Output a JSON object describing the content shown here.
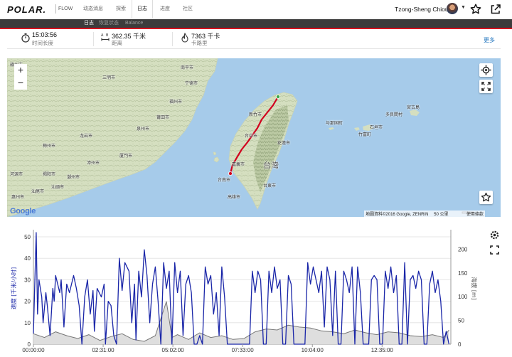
{
  "nav": {
    "logo": "POLAR.",
    "product": "FLOW",
    "tabs": [
      {
        "label": "动态消息"
      },
      {
        "label": "探索"
      },
      {
        "label": "日志"
      },
      {
        "label": "进度"
      },
      {
        "label": "社区"
      }
    ],
    "active_tab": "日志",
    "user_name": "Tzong-Sheng Chiou",
    "icons": [
      "avatar",
      "chevron-down-icon",
      "star-icon",
      "share-icon"
    ]
  },
  "subnav": {
    "tabs": [
      {
        "label": "日志"
      },
      {
        "label": "恢复状态"
      },
      {
        "label": "Balance"
      }
    ],
    "active_tab": "日志"
  },
  "summary": {
    "duration": {
      "value": "15:03:56",
      "label": "时间长度"
    },
    "distance": {
      "value": "362.35 千米",
      "label": "距离"
    },
    "calories": {
      "value": "7363 千卡",
      "label": "卡路里"
    },
    "more_label": "更多"
  },
  "map": {
    "zoom_in": "+",
    "zoom_out": "−",
    "google_logo": "Google",
    "attribution": "地圖資料©2016 Google, ZENRIN",
    "scale_label": "50 公里",
    "terms": "使用條款",
    "labels": [
      {
        "text": "赣州市"
      },
      {
        "text": "三明市"
      },
      {
        "text": "南平市"
      },
      {
        "text": "宁德市"
      },
      {
        "text": "福州市"
      },
      {
        "text": "莆田市"
      },
      {
        "text": "泉州市"
      },
      {
        "text": "厦門市"
      },
      {
        "text": "漳州市"
      },
      {
        "text": "梅州市"
      },
      {
        "text": "龙岩市"
      },
      {
        "text": "河源市"
      },
      {
        "text": "汕頭市"
      },
      {
        "text": "汕尾市"
      },
      {
        "text": "惠州市"
      },
      {
        "text": "揭阳市"
      },
      {
        "text": "潮州市"
      },
      {
        "text": "新竹市"
      },
      {
        "text": "台中市"
      },
      {
        "text": "嘉義市"
      },
      {
        "text": "台南市"
      },
      {
        "text": "高雄市"
      },
      {
        "text": "台灣"
      },
      {
        "text": "花蓮市"
      },
      {
        "text": "台東市"
      },
      {
        "text": "宮古島"
      },
      {
        "text": "多良間村"
      },
      {
        "text": "石垣市"
      },
      {
        "text": "与那国町"
      },
      {
        "text": "竹富町"
      }
    ],
    "route_color": "#d2001e",
    "water_color": "#a6cbea",
    "land_color": "#d8e2c4"
  },
  "chart_data": {
    "type": "line",
    "x_tick_labels": [
      "00:00:00",
      "02:31:00",
      "05:02:00",
      "07:33:00",
      "10:04:00",
      "12:35:00"
    ],
    "x_ticks_hours": [
      0,
      2.5167,
      5.0333,
      7.55,
      10.0667,
      12.5833
    ],
    "xlim_hours": [
      0,
      15.0656
    ],
    "left_axis": {
      "label": "速度 [千米/小时]",
      "ylim": [
        0,
        52
      ],
      "ticks": [
        0,
        10,
        20,
        30,
        40,
        50
      ]
    },
    "right_axis": {
      "label": "海拔 [m]",
      "ylim": [
        0,
        235
      ],
      "ticks": [
        0,
        50,
        100,
        150,
        200
      ]
    },
    "series": [
      {
        "name": "速度 [千米/小时]",
        "axis": "left",
        "color": "#1a26a8",
        "x_hours": [
          0,
          0.1,
          0.15,
          0.2,
          0.3,
          0.35,
          0.45,
          0.5,
          0.6,
          0.7,
          0.75,
          0.8,
          0.95,
          1.0,
          1.1,
          1.2,
          1.3,
          1.45,
          1.55,
          1.65,
          1.75,
          1.85,
          1.95,
          2.05,
          2.15,
          2.2,
          2.3,
          2.45,
          2.55,
          2.6,
          2.7,
          2.8,
          2.9,
          3.0,
          3.1,
          3.2,
          3.3,
          3.45,
          3.55,
          3.65,
          3.7,
          3.8,
          3.9,
          4.0,
          4.1,
          4.2,
          4.3,
          4.4,
          4.5,
          4.6,
          4.7,
          4.8,
          4.9,
          5.0,
          5.1,
          5.2,
          5.3,
          5.4,
          5.5,
          5.6,
          5.7,
          5.8,
          5.9,
          6.0,
          6.1,
          6.2,
          6.3,
          6.4,
          6.5,
          6.6,
          6.7,
          6.8,
          6.9,
          7.0,
          7.1,
          7.2,
          7.3,
          7.4,
          7.5,
          7.6,
          7.7,
          7.8,
          7.9,
          8.0,
          8.1,
          8.2,
          8.3,
          8.4,
          8.5,
          8.6,
          8.7,
          8.8,
          8.9,
          9.0,
          9.1,
          9.2,
          9.3,
          9.4,
          9.5,
          9.6,
          9.7,
          9.8,
          9.9,
          10.0,
          10.1,
          10.2,
          10.3,
          10.4,
          10.5,
          10.6,
          10.7,
          10.8,
          10.9,
          11.0,
          11.1,
          11.2,
          11.3,
          11.4,
          11.5,
          11.6,
          11.7,
          11.8,
          11.9,
          12.0,
          12.1,
          12.2,
          12.3,
          12.4,
          12.5,
          12.6,
          12.7,
          12.8,
          12.9,
          13.0,
          13.1,
          13.2,
          13.3,
          13.4,
          13.5,
          13.6,
          13.7,
          13.8,
          13.9,
          14.0,
          14.1,
          14.2,
          14.3,
          14.4,
          14.5,
          14.6,
          14.7,
          14.8,
          14.9,
          15.0
        ],
        "values": [
          5,
          52,
          14,
          30,
          22,
          10,
          24,
          18,
          4,
          26,
          20,
          32,
          24,
          30,
          8,
          28,
          24,
          32,
          26,
          18,
          0,
          22,
          30,
          14,
          25,
          6,
          26,
          22,
          28,
          0,
          20,
          18,
          4,
          0,
          40,
          25,
          38,
          34,
          10,
          28,
          2,
          34,
          22,
          44,
          32,
          10,
          28,
          36,
          20,
          0,
          38,
          26,
          34,
          0,
          38,
          24,
          34,
          4,
          28,
          32,
          24,
          0,
          0,
          4,
          0,
          36,
          28,
          32,
          14,
          24,
          4,
          36,
          22,
          0,
          0,
          0,
          0,
          0,
          0,
          0,
          0,
          0,
          34,
          24,
          34,
          30,
          0,
          0,
          34,
          24,
          36,
          26,
          30,
          0,
          0,
          32,
          28,
          0,
          0,
          0,
          0,
          0,
          38,
          28,
          36,
          30,
          24,
          34,
          8,
          36,
          30,
          4,
          34,
          0,
          0,
          34,
          30,
          24,
          36,
          0,
          36,
          24,
          0,
          0,
          0,
          30,
          32,
          30,
          0,
          0,
          34,
          26,
          36,
          24,
          32,
          0,
          0,
          38,
          0,
          30,
          32,
          26,
          34,
          30,
          0,
          0,
          28,
          34,
          24,
          30,
          20,
          0,
          6,
          0,
          4
        ]
      },
      {
        "name": "海拔 [m]",
        "axis": "right",
        "color": "#777777",
        "x_hours": [
          0,
          0.4,
          0.8,
          1.2,
          1.6,
          2.0,
          2.4,
          2.8,
          3.2,
          3.6,
          4.0,
          4.4,
          4.8,
          5.0,
          5.2,
          5.6,
          6.0,
          6.4,
          6.8,
          7.2,
          7.6,
          8.0,
          8.4,
          8.8,
          9.2,
          9.6,
          10.0,
          10.4,
          10.8,
          11.2,
          11.6,
          12.0,
          12.4,
          12.8,
          13.2,
          13.6,
          14.0,
          14.4,
          14.8,
          15.0
        ],
        "values": [
          22,
          14,
          26,
          18,
          12,
          20,
          8,
          16,
          22,
          10,
          6,
          18,
          90,
          14,
          20,
          10,
          24,
          14,
          18,
          10,
          12,
          26,
          32,
          30,
          40,
          36,
          34,
          28,
          26,
          22,
          30,
          24,
          20,
          26,
          24,
          18,
          16,
          20,
          14,
          30
        ]
      }
    ],
    "grid": true,
    "legend": "none"
  }
}
